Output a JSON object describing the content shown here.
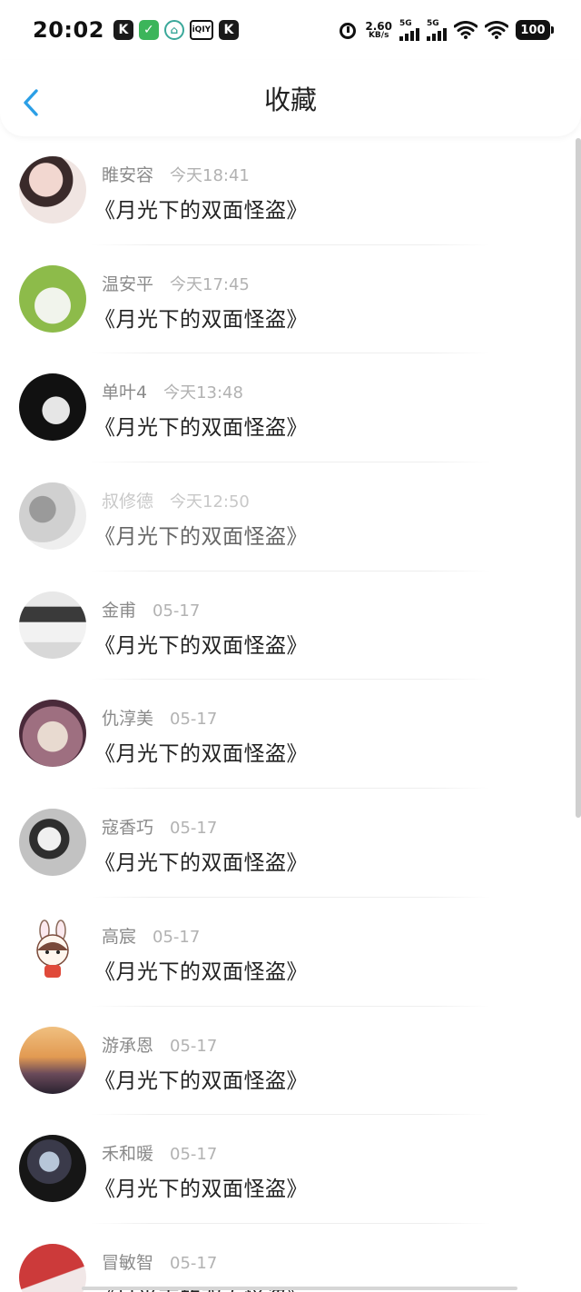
{
  "status_bar": {
    "time": "20:02",
    "notifications": [
      "K",
      "✓",
      "⌂",
      "iQIY",
      "K"
    ],
    "speed_value": "2.60",
    "speed_unit": "KB/s",
    "signal1_label": "5G",
    "signal2_label": "5G",
    "battery": "100"
  },
  "header": {
    "title": "收藏",
    "back_icon": "chevron-left-icon",
    "accent_color": "#2b9fe6"
  },
  "items": [
    {
      "name": "睢安容",
      "time": "今天18:41",
      "title": "《月光下的双面怪盗》",
      "avatar_colors": [
        "#f2d7d0",
        "#2a2020"
      ]
    },
    {
      "name": "温安平",
      "time": "今天17:45",
      "title": "《月光下的双面怪盗》",
      "avatar_colors": [
        "#8dbb4a",
        "#e9f1e2"
      ]
    },
    {
      "name": "单叶4",
      "time": "今天13:48",
      "title": "《月光下的双面怪盗》",
      "avatar_colors": [
        "#111111",
        "#e6e6e6"
      ]
    },
    {
      "name": "叔修德",
      "time": "今天12:50",
      "title": "《月光下的双面怪盗》",
      "avatar_colors": [
        "#bdbdbd",
        "#eeeeee"
      ]
    },
    {
      "name": "金甫",
      "time": "05-17",
      "title": "《月光下的双面怪盗》",
      "avatar_colors": [
        "#d8d8d8",
        "#3a3a3a"
      ]
    },
    {
      "name": "仇淳美",
      "time": "05-17",
      "title": "《月光下的双面怪盗》",
      "avatar_colors": [
        "#9e6f80",
        "#e8dad0"
      ]
    },
    {
      "name": "寇香巧",
      "time": "05-17",
      "title": "《月光下的双面怪盗》",
      "avatar_colors": [
        "#c2c2c2",
        "#2e2e2e"
      ]
    },
    {
      "name": "高宸",
      "time": "05-17",
      "title": "《月光下的双面怪盗》",
      "avatar_colors": [
        "#ffffff",
        "#d9473a"
      ]
    },
    {
      "name": "游承恩",
      "time": "05-17",
      "title": "《月光下的双面怪盗》",
      "avatar_colors": [
        "#e29a52",
        "#2a2230"
      ]
    },
    {
      "name": "禾和暖",
      "time": "05-17",
      "title": "《月光下的双面怪盗》",
      "avatar_colors": [
        "#161616",
        "#b7c6d8"
      ]
    },
    {
      "name": "冒敏智",
      "time": "05-17",
      "title": "《月光下的双面怪盗》",
      "avatar_colors": [
        "#cc3a3a",
        "#f1e7e7"
      ]
    }
  ]
}
